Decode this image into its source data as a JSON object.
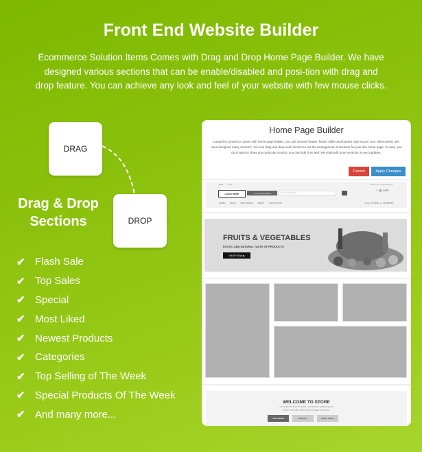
{
  "header": {
    "title": "Front End Website Builder",
    "intro": "Ecommerce Solution Items Comes with Drag and Drop Home Page Builder. We have designed various sections that can be enable/disabled and posi-tion with drag and drop feature. You can achieve any look and feel of your website with few mouse clicks."
  },
  "dragdrop": {
    "drag_label": "DRAG",
    "drop_label": "DROP",
    "title_line1": "Drag & Drop",
    "title_line2": "Sections"
  },
  "features": [
    "Flash Sale",
    "Top Sales",
    "Special",
    "Most Liked",
    "Newest Products",
    "Categories",
    "Top Selling of The Week",
    "Special Products Of The Week",
    "And many more..."
  ],
  "builder": {
    "title": "Home Page Builder",
    "description": "Laravel Ecommerce comes with home page builder, you can choose header, footer, slider and banner style as per your client needs. We have designed many sections. You can drag and drop each section to set the arrangement of sections for your site home page. In case, you don't want to show any purticular section, you can hide it as well. We shall add more sections in next updates.",
    "cancel_label": "Cancel",
    "apply_label": "Apply Changes",
    "accent_cancel": "#d9443a",
    "accent_apply": "#3b8ec8",
    "header_mock": {
      "currency": "USD",
      "welcome": "Welcome!  Login/Register",
      "logo": "LOGO HERE",
      "all_categories": "ALL CATEGORIES",
      "search_placeholder": "Search Products...",
      "cart_label": "CART",
      "cart_items": "0 items",
      "nav": [
        "HOME",
        "SHOP",
        "INFO PAGES",
        "NEWS",
        "CONTACT US"
      ],
      "phone": "CALL US NOW: +1 123456789"
    },
    "banner": {
      "heading": "FRUITS & VEGETABLES",
      "subheading": "EXOTIC AND NATURAL TASTE OF PRODUCTS",
      "button": "SHOP NOW ▶"
    },
    "welcome": {
      "heading": "WELCOME TO STORE",
      "text_line1": "Lorem ipsum dolor sit amet, consectetur adipiscing elit.",
      "text_line2": "Morbi venenatis felis tempus feugiat maximus.",
      "tabs": [
        "TOP SALES",
        "SPECIAL",
        "MOST LIKED"
      ]
    }
  }
}
